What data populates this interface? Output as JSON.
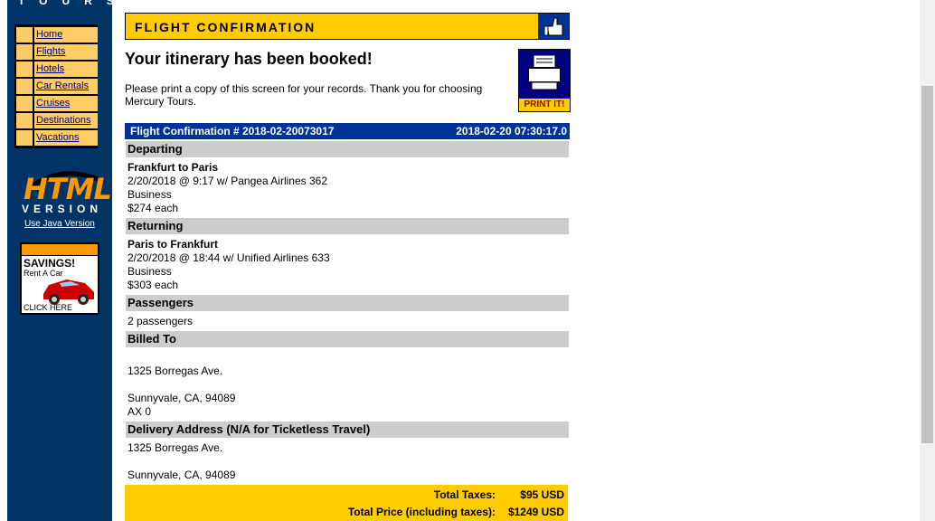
{
  "sidebar": {
    "logo_text": "TOURS",
    "nav": [
      "Home",
      "Flights",
      "Hotels",
      "Car Rentals",
      "Cruises",
      "Destinations",
      "Vacations"
    ],
    "html_badge": "HTML",
    "version_badge": "VERSION",
    "java_link": "Use Java Version",
    "ad_title": "SAVINGS!",
    "ad_sub": "Rent A Car",
    "ad_click": "CLICK HERE"
  },
  "header": {
    "title": "FLIGHT CONFIRMATION"
  },
  "main": {
    "booked": "Your itinerary has been booked!",
    "print_msg": "Please print a copy of this screen for your records. Thank you for choosing Mercury Tours.",
    "print_button": "PRINT IT!",
    "confirmation_number": "Flight Confirmation # 2018-02-20073017",
    "confirmation_time": "2018-02-20 07:30:17.0",
    "departing_label": "Departing",
    "departing_route": "Frankfurt to Paris",
    "departing_flight": "2/20/2018 @ 9:17 w/ Pangea Airlines 362",
    "departing_class": "Business",
    "departing_price": "$274 each",
    "returning_label": "Returning",
    "returning_route": "Paris to Frankfurt",
    "returning_flight": "2/20/2018 @ 18:44 w/ Unified Airlines 633",
    "returning_class": "Business",
    "returning_price": "$303 each",
    "passengers_label": "Passengers",
    "passengers": "2 passengers",
    "billed_label": "Billed To",
    "billed_addr1": "1325 Borregas Ave.",
    "billed_addr2": "Sunnyvale, CA, 94089",
    "billed_card": "AX 0",
    "delivery_label": "Delivery Address (N/A for Ticketless Travel)",
    "delivery_addr1": "1325 Borregas Ave.",
    "delivery_addr2": "Sunnyvale, CA, 94089",
    "total_taxes_label": "Total Taxes:",
    "total_taxes": "$95 USD",
    "total_price_label": "Total Price (including taxes):",
    "total_price": "$1249 USD"
  },
  "colors": {
    "sidebar_bg": "#003366",
    "header_yellow": "#ffcc00",
    "conf_blue": "#003399",
    "section_gray": "#cccccc"
  }
}
